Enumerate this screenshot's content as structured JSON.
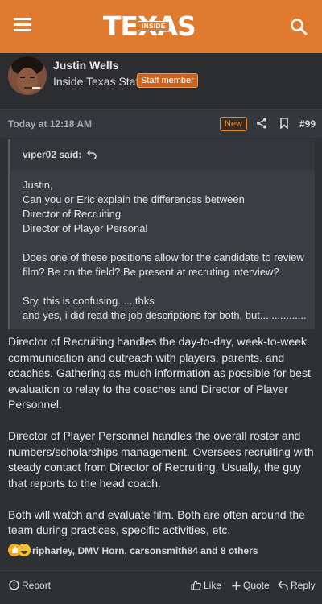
{
  "header": {
    "logo_text": "TEXAS",
    "logo_badge": "INSIDE",
    "menu_icon": "hamburger-menu-icon",
    "search_icon": "search-icon",
    "brand_color": "#e07a2e"
  },
  "author": {
    "name": "Justin Wells",
    "title": "Inside Texas Staff",
    "badge": "Staff member"
  },
  "post": {
    "date": "Today at 12:18 AM",
    "new_label": "New",
    "number": "#99"
  },
  "quote": {
    "author": "viper02 said:",
    "paragraphs": [
      "Justin,\nCan you or Eric explain the differences between\nDirector of Recruiting\nDirector of Player Personal",
      "Does one of these positions allow for the candidate to review film? Be on the field? Be present at recruting interview?",
      "Sry, this is confusing......thks\nand yes, i did read the job descriptions for both, but................"
    ]
  },
  "body": {
    "paragraphs": [
      "Director of Recruiting handles the day-to-day, week-to-week communication and outreach with players, parents. and coaches. Gathering as much information as possible for best evaluation to relay to the coaches and Director of Player Personnel.",
      "Director of Player Personnel handles the overall roster and numbers/scholarships management. Oversees recruiting with steady contact from Director of Recruiting. Usually, the guy that reports to the head coach.",
      "Both will watch and evaluate film. Both are often around the team during practices, specific activities, etc."
    ]
  },
  "reactions": {
    "text": "ripharley, DMV Horn, carsonsmith84 and 8 others"
  },
  "actions": {
    "report": "Report",
    "like": "Like",
    "quote": "Quote",
    "reply": "Reply"
  }
}
